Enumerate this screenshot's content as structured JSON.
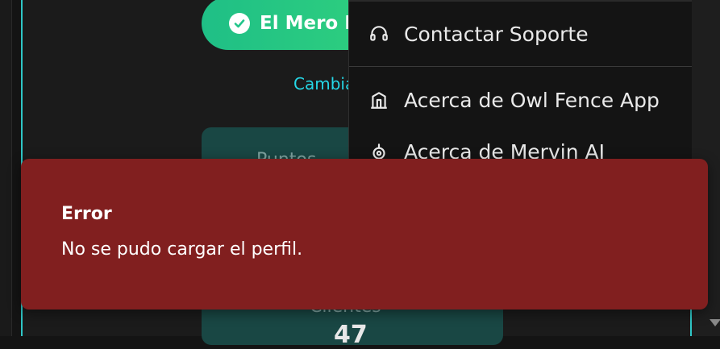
{
  "header": {
    "profile_pill_label": "El Mero M"
  },
  "profile": {
    "change_link": "Cambiar"
  },
  "stats_card": {
    "top_label": "Puntos",
    "bottom_label": "Clientes",
    "bottom_value": "47"
  },
  "menu": {
    "items": [
      {
        "label": "Contactar Soporte",
        "icon": "headset-icon"
      },
      {
        "label": "Acerca de Owl Fence App",
        "icon": "building-icon"
      },
      {
        "label": "Acerca de Mervin AI",
        "icon": "robot-icon"
      }
    ]
  },
  "toast": {
    "title": "Error",
    "message": "No se pudo cargar el perfil."
  },
  "colors": {
    "accent": "#2fc7c7",
    "pill_green": "#22c58a",
    "error_bg": "#811f1f",
    "card_bg": "#194744"
  }
}
